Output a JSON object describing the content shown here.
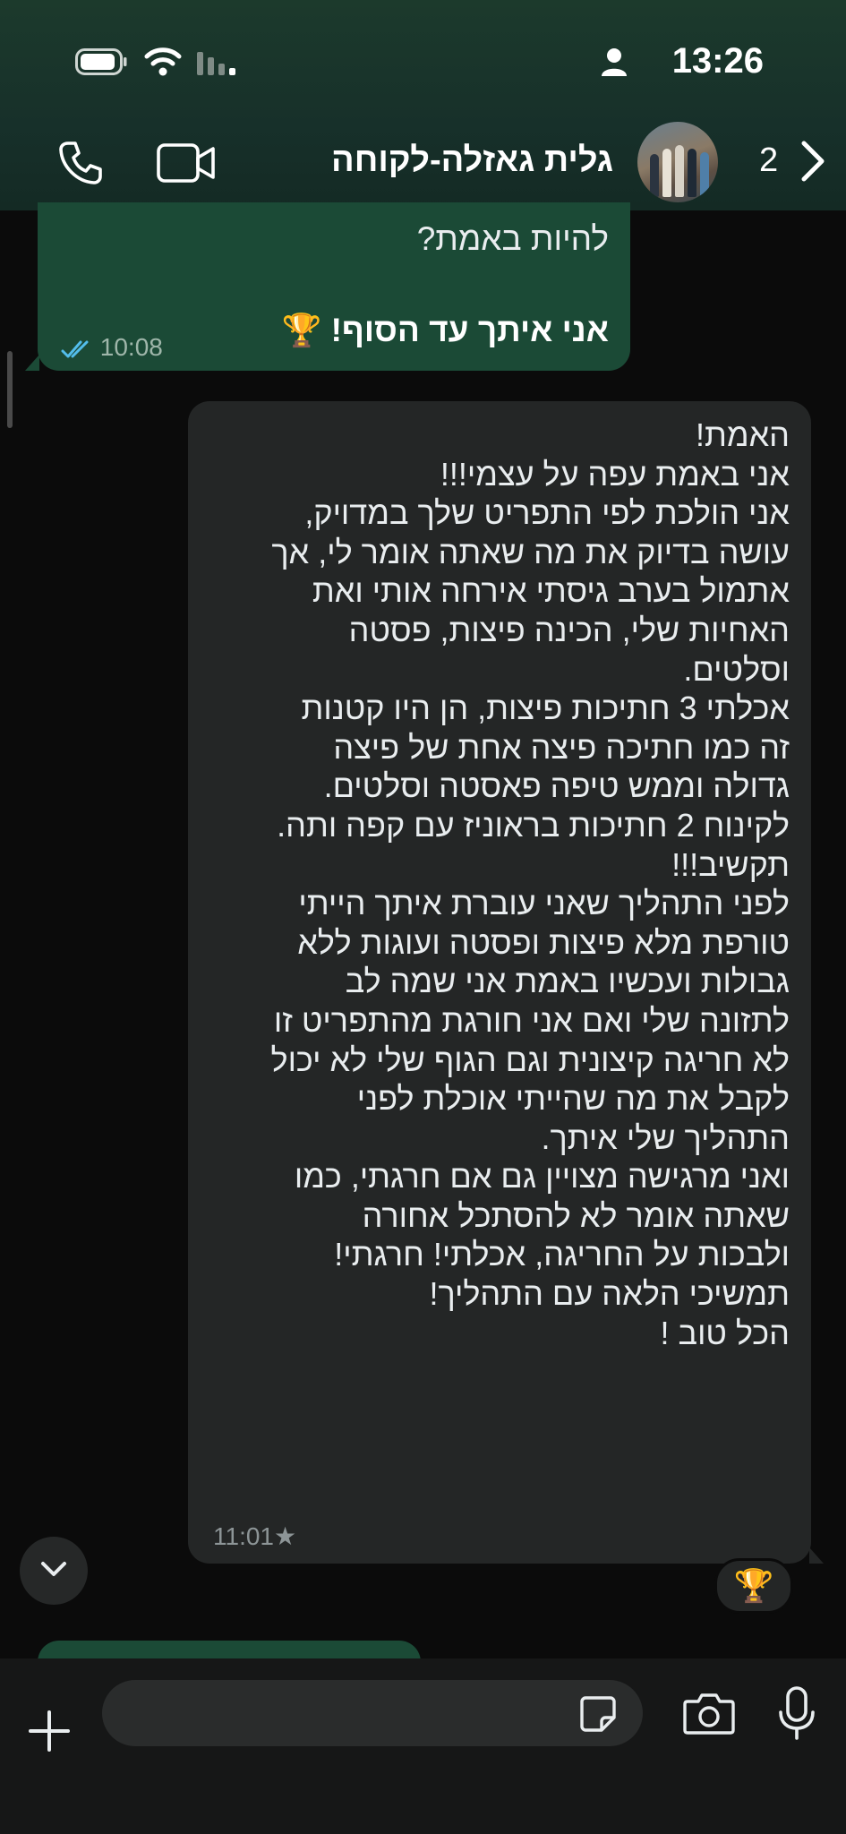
{
  "status_bar": {
    "time": "13:26"
  },
  "header": {
    "contact_name": "גלית גאזלה-לקוחה",
    "back_count": "2"
  },
  "outgoing_message": {
    "line1": "להיות באמת?",
    "line2": "אני איתך עד הסוף!",
    "emoji": "🏆",
    "time": "10:08",
    "status": "read"
  },
  "incoming_message": {
    "lines": [
      "האמת!",
      "אני באמת עפה על עצמי!!!",
      "אני הולכת לפי התפריט שלך  במדויק,",
      "עושה בדיוק את מה שאתה אומר לי, אך",
      "אתמול בערב גיסתי אירחה אותי ואת",
      "האחיות שלי, הכינה פיצות, פסטה",
      "וסלטים.",
      "אכלתי 3 חתיכות פיצות, הן היו קטנות",
      "זה כמו חתיכה פיצה אחת של פיצה",
      "גדולה וממש טיפה פאסטה וסלטים.",
      "לקינוח 2 חתיכות בראוניז עם קפה ותה.",
      "תקשיב!!!",
      "לפני התהליך שאני עוברת איתך הייתי",
      "טורפת מלא פיצות ופסטה ועוגות ללא",
      "גבולות ועכשיו באמת אני שמה לב",
      "לתזונה שלי ואם אני חורגת מהתפריט זו",
      "לא חריגה קיצונית וגם הגוף שלי לא יכול",
      "לקבל את מה שהייתי אוכלת לפני",
      "התהליך  שלי איתך.",
      "ואני מרגישה מצויין גם אם חרגתי, כמו",
      "שאתה אומר לא להסתכל אחורה",
      "ולבכות על החריגה, אכלתי! חרגתי!",
      "תמשיכי הלאה  עם התהליך!",
      "הכל טוב !"
    ],
    "time": "11:01",
    "starred": "★",
    "reaction": "🏆"
  },
  "input_bar": {
    "placeholder": ""
  }
}
